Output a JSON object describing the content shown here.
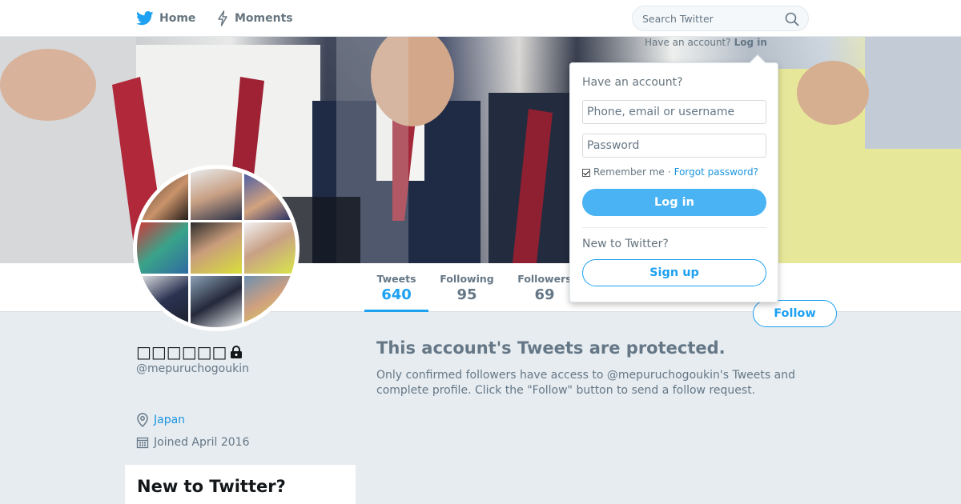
{
  "nav": {
    "home_label": "Home",
    "moments_label": "Moments",
    "search_placeholder": "Search Twitter",
    "have_account_text": "Have an account?",
    "login_link": "Log in"
  },
  "profile": {
    "name": "□□□□□□",
    "screen_name": "@mepuruchogoukin",
    "location": "Japan",
    "joined": "Joined April 2016",
    "stats": [
      {
        "label": "Tweets",
        "value": "640"
      },
      {
        "label": "Following",
        "value": "95"
      },
      {
        "label": "Followers",
        "value": "69"
      }
    ],
    "follow_label": "Follow"
  },
  "protected": {
    "title": "This account's Tweets are protected.",
    "text": "Only confirmed followers have access to @mepuruchogoukin's Tweets and complete profile. Click the \"Follow\" button to send a follow request."
  },
  "login_dropdown": {
    "heading": "Have an account?",
    "username_placeholder": "Phone, email or username",
    "password_placeholder": "Password",
    "remember_me": "Remember me",
    "separator": "·",
    "forgot_password": "Forgot password?",
    "login_button": "Log in",
    "new_heading": "New to Twitter?",
    "signup_button": "Sign up"
  },
  "sidebar_card": {
    "title": "New to Twitter?"
  },
  "colors": {
    "accent": "#1da1f2",
    "background": "#e6ecf0",
    "secondary_text": "#657786"
  },
  "icons": [
    "twitter-bird-icon",
    "lightning-icon",
    "search-icon",
    "lock-icon",
    "location-pin-icon",
    "calendar-icon"
  ]
}
